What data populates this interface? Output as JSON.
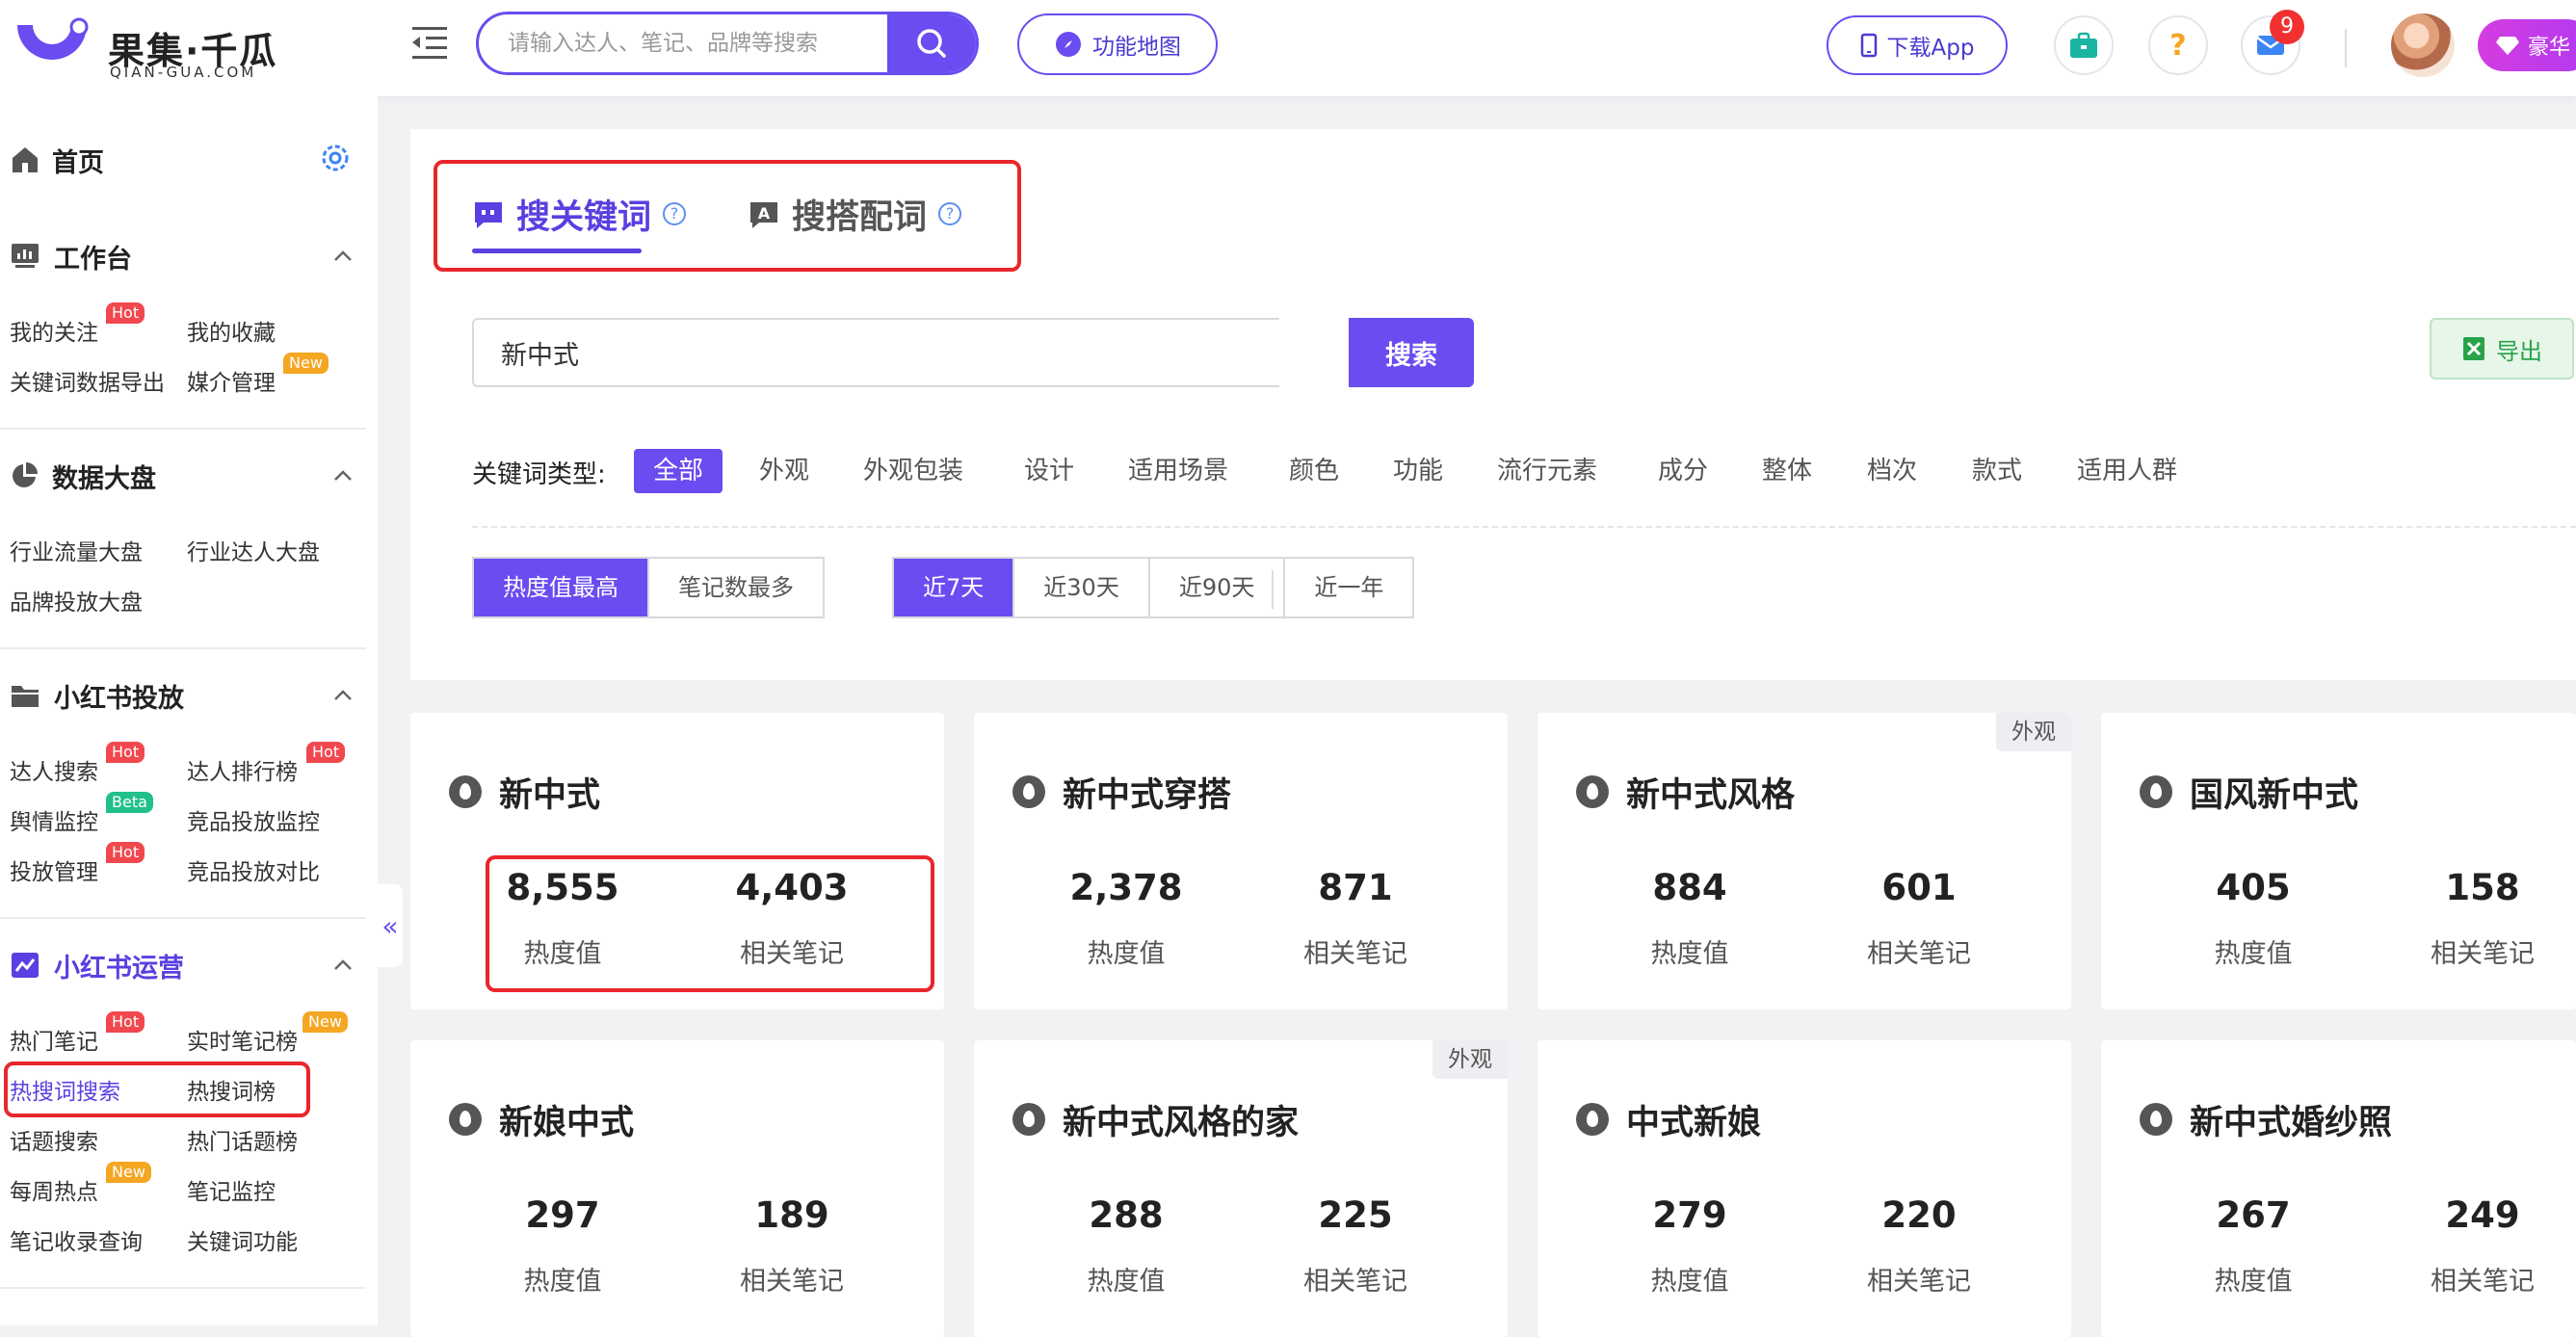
{
  "header": {
    "logo_title": "果集·千瓜",
    "logo_sub": "QIAN-GUA.COM",
    "search_placeholder": "请输入达人、笔记、品牌等搜索",
    "map_label": "功能地图",
    "download_label": "下载App",
    "mail_count": "9",
    "vip_label": "豪华"
  },
  "sidebar": {
    "home": "首页",
    "sections": [
      {
        "title": "工作台",
        "items": [
          "我的关注",
          "我的收藏",
          "关键词数据导出",
          "媒介管理"
        ]
      },
      {
        "title": "数据大盘",
        "items": [
          "行业流量大盘",
          "行业达人大盘",
          "品牌投放大盘"
        ]
      },
      {
        "title": "小红书投放",
        "items": [
          "达人搜索",
          "达人排行榜",
          "舆情监控",
          "竞品投放监控",
          "投放管理",
          "竞品投放对比"
        ]
      },
      {
        "title": "小红书运营",
        "items": [
          "热门笔记",
          "实时笔记榜",
          "热搜词搜索",
          "热搜词榜",
          "话题搜索",
          "热门话题榜",
          "每周热点",
          "笔记监控",
          "笔记收录查询",
          "关键词功能"
        ]
      }
    ],
    "tags": {
      "hot": "Hot",
      "new": "New",
      "beta": "Beta"
    },
    "collapse": "«"
  },
  "main": {
    "tabs": [
      "搜关键词",
      "搜搭配词"
    ],
    "query": "新中式",
    "search_btn": "搜索",
    "export_btn": "导出",
    "filter_label": "关键词类型:",
    "filters": [
      "全部",
      "外观",
      "外观包装",
      "设计",
      "适用场景",
      "颜色",
      "功能",
      "流行元素",
      "成分",
      "整体",
      "档次",
      "款式",
      "适用人群"
    ],
    "sort_options": [
      "热度值最高",
      "笔记数最多"
    ],
    "time_options": [
      "近7天",
      "近30天",
      "近90天",
      "近一年"
    ],
    "metric_labels": {
      "heat": "热度值",
      "notes": "相关笔记"
    },
    "cards": [
      {
        "title": "新中式",
        "heat": "8,555",
        "notes": "4,403",
        "tag": ""
      },
      {
        "title": "新中式穿搭",
        "heat": "2,378",
        "notes": "871",
        "tag": ""
      },
      {
        "title": "新中式风格",
        "heat": "884",
        "notes": "601",
        "tag": "外观"
      },
      {
        "title": "国风新中式",
        "heat": "405",
        "notes": "158",
        "tag": ""
      },
      {
        "title": "新娘中式",
        "heat": "297",
        "notes": "189",
        "tag": ""
      },
      {
        "title": "新中式风格的家",
        "heat": "288",
        "notes": "225",
        "tag": "外观"
      },
      {
        "title": "中式新娘",
        "heat": "279",
        "notes": "220",
        "tag": ""
      },
      {
        "title": "新中式婚纱照",
        "heat": "267",
        "notes": "249",
        "tag": ""
      }
    ]
  },
  "colors": {
    "accent": "#6a4cf0",
    "highlight": "#e8262b",
    "hot": "#f0484e",
    "new": "#f5a623",
    "beta": "#21c08b"
  }
}
